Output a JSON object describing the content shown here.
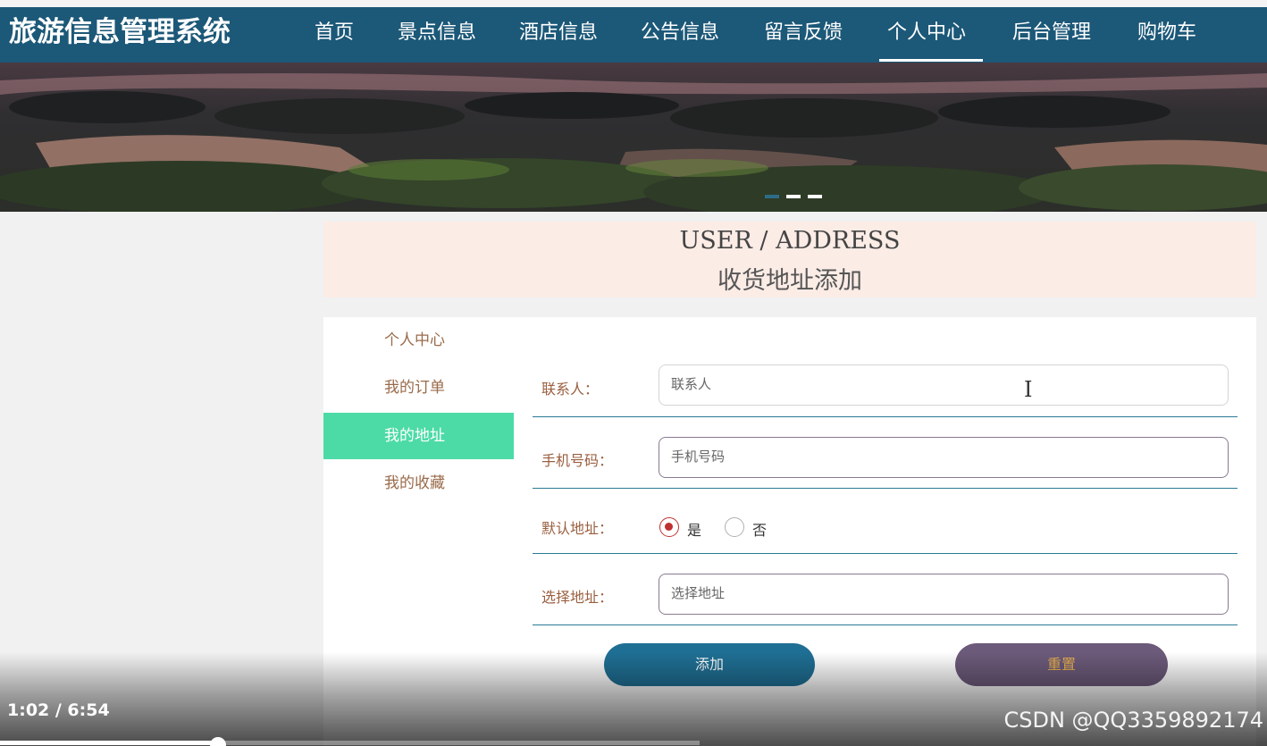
{
  "app": {
    "title": "旅游信息管理系统"
  },
  "nav": {
    "items": [
      "首页",
      "景点信息",
      "酒店信息",
      "公告信息",
      "留言反馈",
      "个人中心",
      "后台管理",
      "购物车"
    ],
    "active": "个人中心"
  },
  "banner": {
    "slide_count": 3,
    "active_slide": 1
  },
  "heading": {
    "en": "USER / ADDRESS",
    "cn": "收货地址添加"
  },
  "sidebar": {
    "items": [
      "个人中心",
      "我的订单",
      "我的地址",
      "我的收藏"
    ],
    "active": "我的地址"
  },
  "form": {
    "contact": {
      "label": "联系人：",
      "placeholder": "联系人",
      "value": ""
    },
    "phone": {
      "label": "手机号码：",
      "placeholder": "手机号码",
      "value": ""
    },
    "default": {
      "label": "默认地址：",
      "options": [
        "是",
        "否"
      ],
      "selected": "是"
    },
    "address": {
      "label": "选择地址：",
      "placeholder": "选择地址",
      "value": ""
    }
  },
  "buttons": {
    "add": "添加",
    "reset": "重置"
  },
  "video": {
    "time": "1:02 / 6:54",
    "progress": 0.15
  },
  "watermark": "CSDN @QQ3359892174",
  "colors": {
    "nav_bg": "#1c5878",
    "sidebar_active": "#4cdba6",
    "add_button": "#1f6f94",
    "reset_button": "#6c5a7a",
    "reset_text": "#e8b04d",
    "label_text": "#9a5f3f"
  }
}
